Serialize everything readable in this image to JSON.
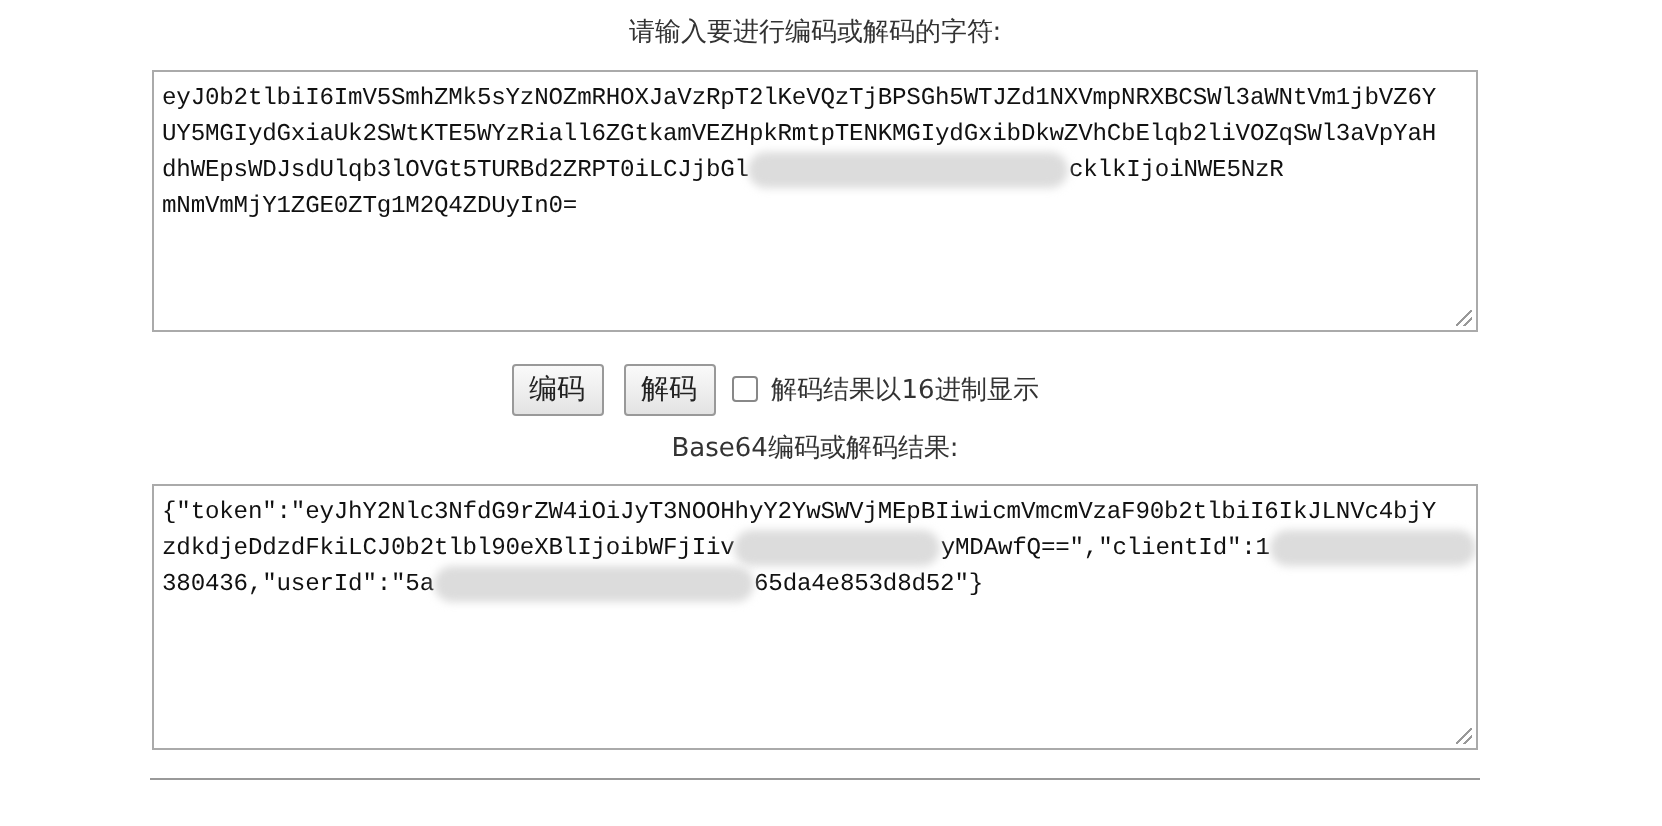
{
  "input_label": "请输入要进行编码或解码的字符:",
  "input": {
    "lines": [
      [
        {
          "text": "eyJ0b2tlbiI6ImV5SmhZMk5sYzNOZmRHOXJaVzRpT2lKeVQzTjBPSGh5WTJZd1NXVmpNRXBCSWl3aWNtVm1jbVZ6Y"
        }
      ],
      [
        {
          "text": "UY5MGIydGxiaUk2SWtKTE5WYzRiall6ZGtkamVEZHpkRmtpTENKMGIydGxibDkwZVhCbElqb2liVOZqSWl3aVpYaH"
        }
      ],
      [
        {
          "text": "dhWEpsWDJsdUlqb3lOVGt5TURBd2ZRPT0iLCJjbGl"
        },
        {
          "kind": "redacted"
        },
        {
          "text": "cklkIjoiNWE5NzR"
        }
      ],
      [
        {
          "text": "mNmVmMjY1ZGE0ZTg1M2Q4ZDUyIn0="
        }
      ]
    ]
  },
  "buttons": [
    {
      "label": "编码"
    },
    {
      "label": "解码"
    }
  ],
  "hex_option": {
    "label": "解码结果以16进制显示",
    "checked": false
  },
  "output_label": "Base64编码或解码结果:",
  "output": {
    "lines": [
      [
        {
          "text": "{\"token\":\"eyJhY2Nlc3NfdG9rZW4iOiJyT3NOOHhyY2YwSWVjMEpBIiwicmVmcmVzaF90b2tlbiI6IkJLNVc4bjY"
        }
      ],
      [
        {
          "text": "zdkdjeDdzdFkiLCJ0b2tlbl90eXBlIjoibWFjIiv"
        },
        {
          "kind": "redacted"
        },
        {
          "text": "yMDAwfQ==\",\"clientId\":1"
        },
        {
          "kind": "redacted"
        }
      ],
      [
        {
          "text": "380436,\"userId\":\"5a"
        },
        {
          "kind": "redacted"
        },
        {
          "text": "65da4e853d8d52\"}"
        }
      ]
    ]
  }
}
